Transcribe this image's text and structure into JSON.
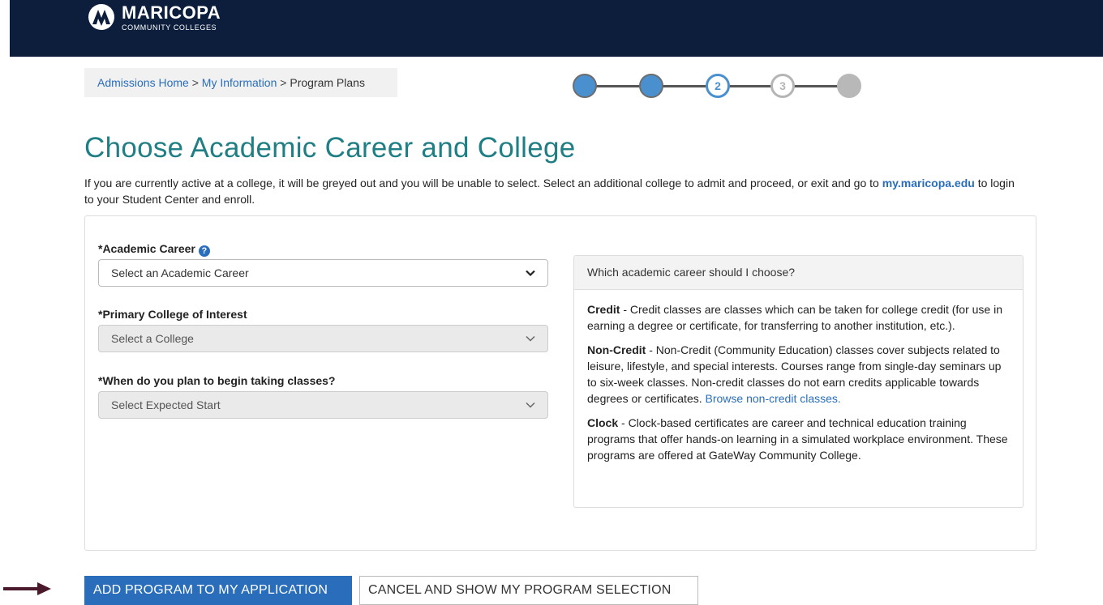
{
  "header": {
    "logo_name": "MARICOPA",
    "logo_sub": "COMMUNITY COLLEGES",
    "bg_color": "#0c1e3c"
  },
  "breadcrumb": {
    "items": [
      "Admissions Home",
      "My Information",
      "Program Plans"
    ],
    "separator": ">"
  },
  "progress": {
    "steps": [
      {
        "state": "done",
        "label": ""
      },
      {
        "state": "done",
        "label": ""
      },
      {
        "state": "current",
        "label": "2"
      },
      {
        "state": "next",
        "label": "3"
      },
      {
        "state": "future",
        "label": ""
      }
    ]
  },
  "page": {
    "title": "Choose Academic Career and College",
    "intro_text": "If you are currently active at a college, it will be greyed out and you will be unable to select. Select an additional college to admit and proceed, or exit and go to",
    "intro_link": "my.maricopa.edu",
    "intro_suffix": " to login to your Student Center and enroll."
  },
  "form": {
    "academic_career": {
      "label": "*Academic Career",
      "placeholder": "Select an Academic Career",
      "help_icon": "question-circle-icon"
    },
    "college": {
      "label": "*Primary College of Interest",
      "placeholder": "Select a College"
    },
    "start": {
      "label": "*When do you plan to begin taking classes?",
      "placeholder": "Select Expected Start"
    }
  },
  "info": {
    "heading": "Which academic career should I choose?",
    "credit_term": "Credit",
    "credit_text": " - Credit classes are classes which can be taken for college credit (for use in earning a degree or certificate, for transferring to another institution, etc.).",
    "noncredit_term": "Non-Credit",
    "noncredit_text": " - Non-Credit (Community Education) classes cover subjects related to leisure, lifestyle, and special interests. Courses range from single-day seminars up to six-week classes. Non-credit classes do not earn credits applicable towards degrees or certificates. ",
    "noncredit_link": "Browse non-credit classes.",
    "clock_term": "Clock",
    "clock_text": " - Clock-based certificates are career and technical education training programs that offer hands-on learning in a simulated workplace environment. These programs are offered at GateWay Community College."
  },
  "actions": {
    "add_label": "ADD PROGRAM TO MY APPLICATION",
    "cancel_label": "CANCEL AND SHOW MY PROGRAM SELECTION"
  },
  "colors": {
    "accent": "#2a6ebb",
    "title": "#1f7f84",
    "arrow": "#4a1a2c"
  }
}
